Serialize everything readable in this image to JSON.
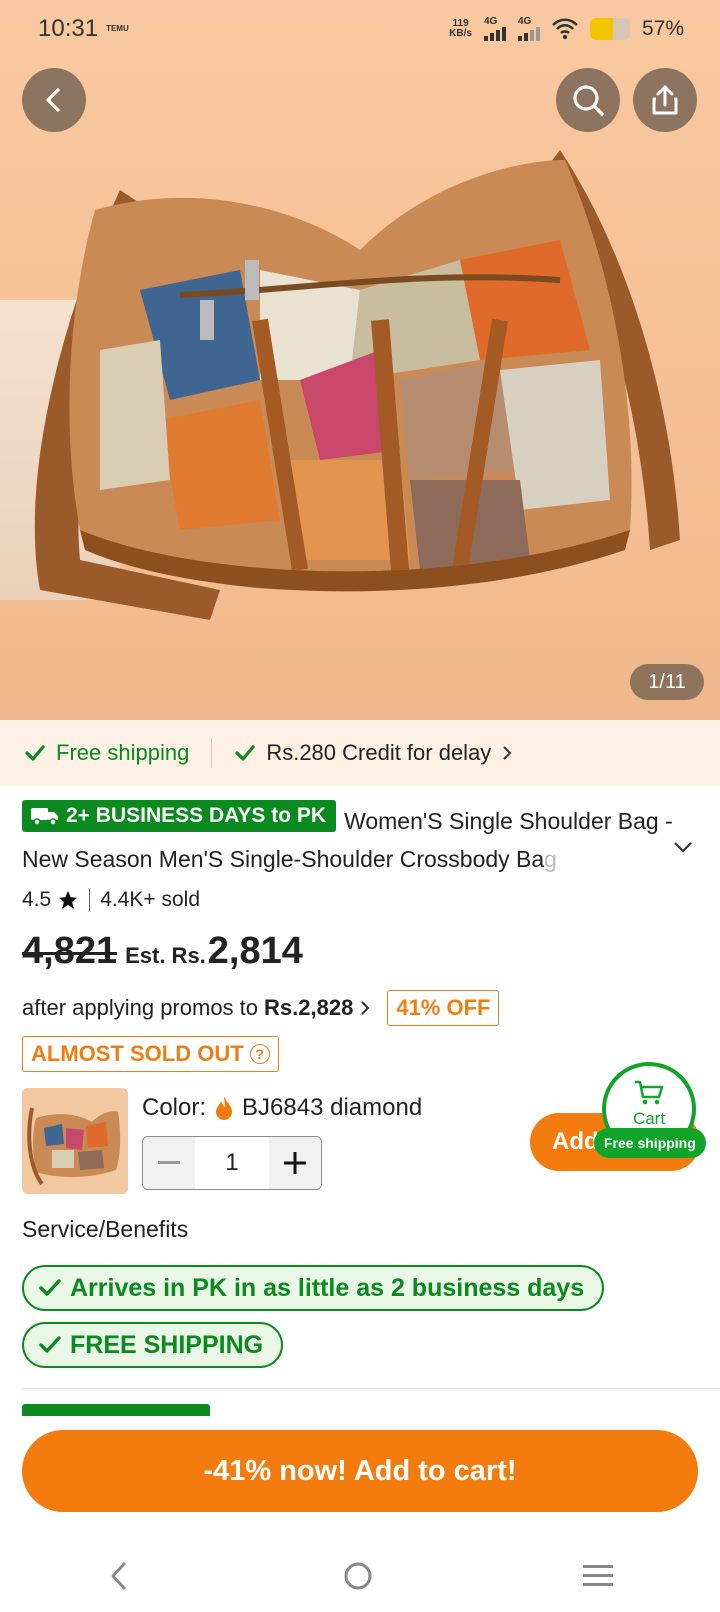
{
  "status_bar": {
    "time": "10:31",
    "temu_tag": "TEMU",
    "speed_value": "119",
    "speed_unit": "KB/s",
    "signal1_label": "4G",
    "signal2_label": "4G",
    "battery_percent": "57%",
    "battery_level": 0.57
  },
  "header": {
    "back_icon": "chevron-left-icon",
    "search_icon": "search-icon",
    "share_icon": "share-icon"
  },
  "gallery": {
    "counter": "1/11"
  },
  "shipping_strip": {
    "free_shipping": "Free shipping",
    "credit_delay": "Rs.280 Credit for delay"
  },
  "product": {
    "badge": "2+ BUSINESS DAYS to PK",
    "title_main": "Women'S Single Shoulder Bag - New Season Men'S Single-Shoulder Crossbody Ba",
    "title_fade": "g",
    "rating": "4.5",
    "sold": "4.4K+ sold",
    "old_price": "4,821",
    "est_label": "Est. Rs.",
    "est_price": "2,814",
    "promo_text": "after applying promos to",
    "promo_price": "Rs.2,828",
    "off_badge": "41% OFF",
    "almost_sold_out": "ALMOST SOLD OUT"
  },
  "variant": {
    "color_label": "Color:",
    "color_value": "BJ6843 diamond",
    "quantity": "1"
  },
  "add_button": {
    "label": "Add"
  },
  "cart_float": {
    "label": "Cart",
    "free_shipping": "Free shipping"
  },
  "services": {
    "title": "Service/Benefits",
    "items": [
      "Arrives in PK in as little as 2 business days",
      "FREE SHIPPING"
    ]
  },
  "cta": {
    "label": "-41% now! Add to cart!"
  },
  "colors": {
    "orange": "#f47c0e",
    "green": "#0a8a1f"
  }
}
